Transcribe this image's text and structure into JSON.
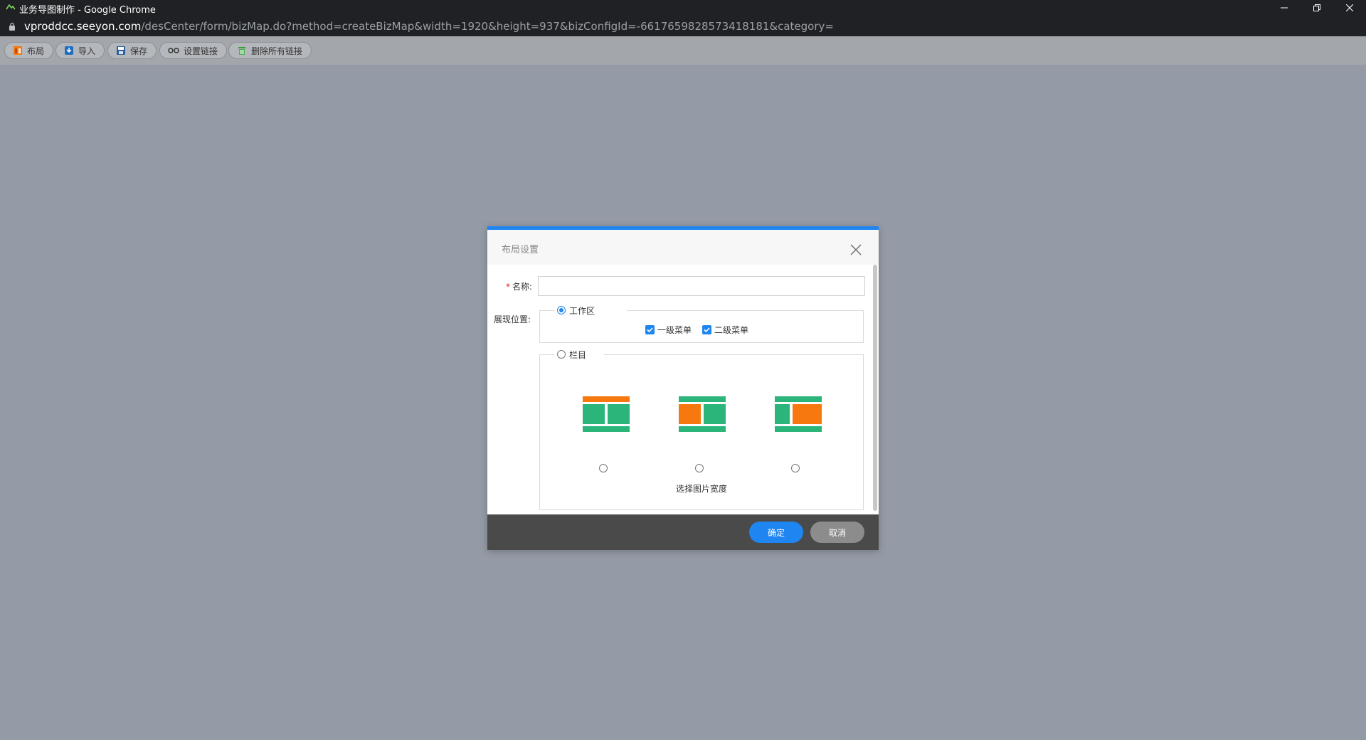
{
  "window": {
    "title": "业务导图制作 - Google Chrome",
    "url_host": "vproddcc.seeyon.com",
    "url_path": "/desCenter/form/bizMap.do?method=createBizMap&width=1920&height=937&bizConfigId=-6617659828573418181&category="
  },
  "toolbar": {
    "buttons": [
      {
        "label": "布局",
        "icon": "layout-icon"
      },
      {
        "label": "导入",
        "icon": "import-icon"
      },
      {
        "label": "保存",
        "icon": "save-icon"
      },
      {
        "label": "设置链接",
        "icon": "link-icon"
      },
      {
        "label": "删除所有链接",
        "icon": "trash-icon"
      }
    ]
  },
  "dialog": {
    "title": "布局设置",
    "name_label": "名称:",
    "name_required_mark": "*",
    "name_value": "",
    "position_label": "展现位置:",
    "workspace": {
      "label": "工作区",
      "selected": true,
      "checkboxes": [
        {
          "label": "一级菜单",
          "checked": true
        },
        {
          "label": "二级菜单",
          "checked": true
        }
      ]
    },
    "column": {
      "label": "栏目",
      "selected": false,
      "options": [
        {
          "icon": "layout-top-orange-icon",
          "selected": false
        },
        {
          "icon": "layout-left-orange-icon",
          "selected": false
        },
        {
          "icon": "layout-right-orange-icon",
          "selected": false
        }
      ],
      "hint": "选择图片宽度"
    },
    "ok_label": "确定",
    "cancel_label": "取消"
  },
  "colors": {
    "accent": "#1f85f0",
    "layout_green": "#2cb57a",
    "layout_orange": "#f7780f",
    "backdrop": "#959ba6",
    "footer": "#4a4a4a"
  }
}
